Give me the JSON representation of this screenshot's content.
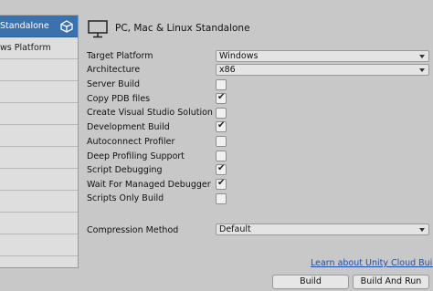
{
  "platforms": {
    "items": [
      {
        "label": "Standalone",
        "selected": true
      },
      {
        "label": "ws Platform",
        "selected": false
      },
      {
        "label": ""
      },
      {
        "label": ""
      },
      {
        "label": ""
      },
      {
        "label": ""
      },
      {
        "label": ""
      },
      {
        "label": ""
      },
      {
        "label": ""
      },
      {
        "label": ""
      },
      {
        "label": ""
      }
    ]
  },
  "header": {
    "title": "PC, Mac & Linux Standalone",
    "icon": "monitor-icon"
  },
  "settings": {
    "target_platform": {
      "label": "Target Platform",
      "value": "Windows"
    },
    "architecture": {
      "label": "Architecture",
      "value": "x86"
    },
    "server_build": {
      "label": "Server Build",
      "checked": false
    },
    "copy_pdb": {
      "label": "Copy PDB files",
      "checked": true
    },
    "create_vs_solution": {
      "label": "Create Visual Studio Solution",
      "checked": false
    },
    "development_build": {
      "label": "Development Build",
      "checked": true
    },
    "autoconnect_profiler": {
      "label": "Autoconnect Profiler",
      "checked": false
    },
    "deep_profiling": {
      "label": "Deep Profiling Support",
      "checked": false
    },
    "script_debugging": {
      "label": "Script Debugging",
      "checked": true
    },
    "wait_managed_debugger": {
      "label": "Wait For Managed Debugger",
      "checked": true
    },
    "scripts_only_build": {
      "label": "Scripts Only Build",
      "checked": false
    },
    "compression_method": {
      "label": "Compression Method",
      "value": "Default"
    }
  },
  "footer": {
    "learn_link": "Learn about Unity Cloud Build",
    "build_label": "Build",
    "build_and_run_label": "Build And Run"
  },
  "colors": {
    "selection": "#3a72b0",
    "link": "#1f4fa8"
  }
}
